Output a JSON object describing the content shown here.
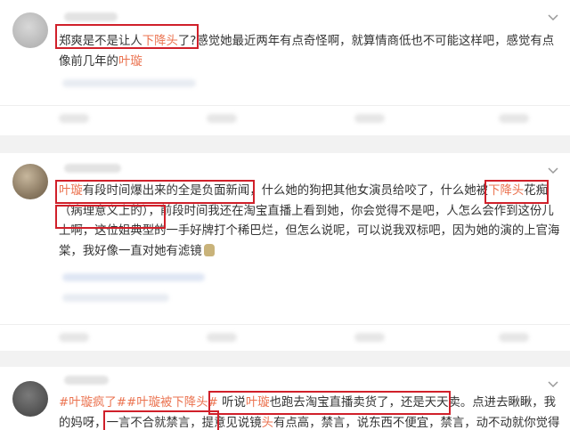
{
  "comments": [
    {
      "seg1": "郑爽是不是让人",
      "seg1_hl": "下降头",
      "seg1_end": "了?",
      "seg2": "感觉她最近两年有点奇怪啊，就算情商低也不可能这样吧，感觉有点像前几年的",
      "seg2_hl": "叶璇"
    },
    {
      "p1_hl": "叶璇",
      "p1": "有段时间爆出来的全是负面新闻",
      "p2": "，什么她的狗把其他女演员给咬了，什么她被",
      "p2_hl": "下降头",
      "p3": "花痴",
      "p4": "（病理意义上的）",
      "p5": "，前段时间我还在淘宝直播上看到她，你会觉得不是吧，人怎么会作到这份儿上啊，这位姐典型的一手好牌打个稀巴烂，但怎么说呢，可以说我双标吧，因为她的演的上官海棠，我好像一直对她有滤镜"
    },
    {
      "tag1": "#叶璇疯了#",
      "tag2": "#",
      "tag2_hl": "叶璇",
      "tag2_end": "被下降头#",
      "q1": "听说",
      "q1_hl": "叶璇",
      "q1_end": "也跑去淘宝直播卖货了，还是天天卖",
      "q2": "。点进去瞅瞅，我的妈呀，",
      "q3": "一言不合就禁言",
      "q4": "，提意见说镜",
      "q4_hl": "头",
      "q4_end": "有点高，禁言，说东西不便宜，禁言，动不动就你觉得"
    }
  ],
  "colors": {
    "highlight": "#eb7350",
    "box": "#d0202a",
    "text": "#333333",
    "gap": "#f2f2f2"
  },
  "icons": {
    "more": "chevron-down-icon",
    "avatar": "avatar"
  }
}
